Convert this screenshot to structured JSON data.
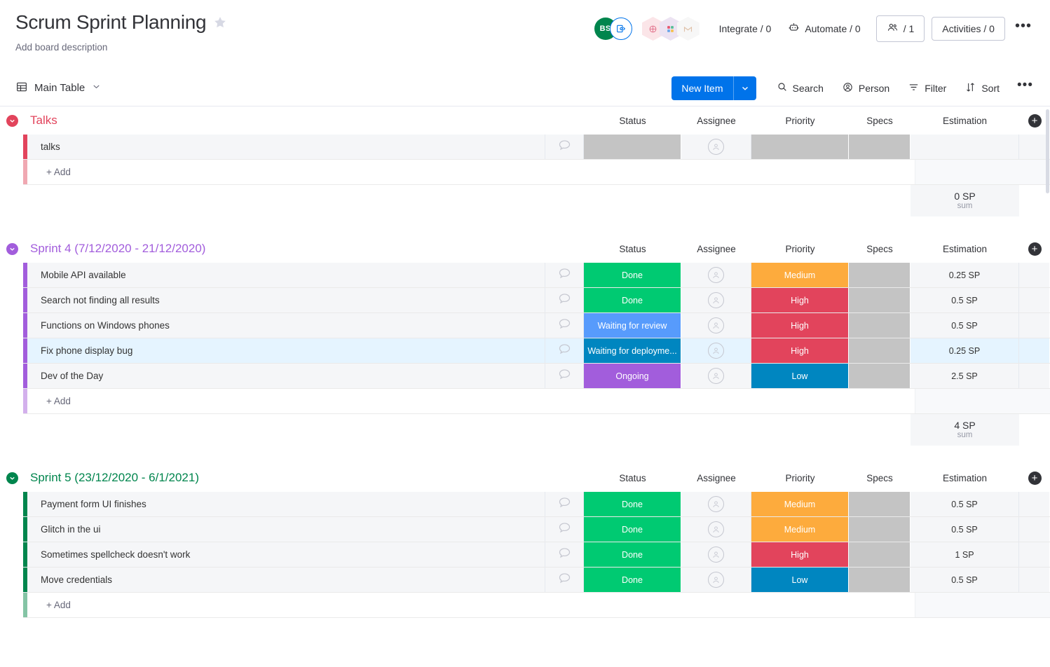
{
  "header": {
    "title": "Scrum Sprint Planning",
    "description": "Add board description",
    "star_icon": "star-icon",
    "avatar_initials": "BS",
    "integrate_label": "Integrate / 0",
    "automate_label": "Automate / 0",
    "people_count": "/ 1",
    "activities_label": "Activities / 0",
    "more_label": "•••"
  },
  "toolbar": {
    "view_label": "Main Table",
    "new_item_label": "New Item",
    "search_label": "Search",
    "person_label": "Person",
    "filter_label": "Filter",
    "sort_label": "Sort",
    "more_label": "•••"
  },
  "columns": {
    "status": "Status",
    "assignee": "Assignee",
    "priority": "Priority",
    "specs": "Specs",
    "estimation": "Estimation"
  },
  "colors": {
    "accent_blue": "#0073ea",
    "group_talks": "#e2445c",
    "group_sprint4": "#a25ddc",
    "group_sprint5": "#00854d",
    "status_done": "#00ca72",
    "status_waiting_review": "#579bfc",
    "status_waiting_deployment": "#0086c0",
    "status_ongoing": "#a25ddc",
    "priority_medium": "#fdab3d",
    "priority_high": "#e2445c",
    "priority_low": "#0086c0",
    "empty_cell": "#c4c4c4"
  },
  "add_label": "+ Add",
  "sum_label": "sum",
  "groups": [
    {
      "name": "Talks",
      "color": "#e2445c",
      "bar_color": "#e2445c",
      "add_bar_color": "#f0a8b2",
      "sum": "0 SP",
      "items": [
        {
          "name": "talks",
          "status": "",
          "status_color": "#c4c4c4",
          "priority": "",
          "priority_color": "#c4c4c4",
          "estimation": "",
          "selected": false
        }
      ]
    },
    {
      "name": "Sprint 4 (7/12/2020 - 21/12/2020)",
      "color": "#a25ddc",
      "bar_color": "#a25ddc",
      "add_bar_color": "#d3b0ec",
      "sum": "4 SP",
      "items": [
        {
          "name": "Mobile API available",
          "status": "Done",
          "status_color": "#00ca72",
          "priority": "Medium",
          "priority_color": "#fdab3d",
          "estimation": "0.25 SP",
          "selected": false
        },
        {
          "name": "Search not finding all results",
          "status": "Done",
          "status_color": "#00ca72",
          "priority": "High",
          "priority_color": "#e2445c",
          "estimation": "0.5 SP",
          "selected": false
        },
        {
          "name": "Functions on Windows phones",
          "status": "Waiting for review",
          "status_color": "#579bfc",
          "priority": "High",
          "priority_color": "#e2445c",
          "estimation": "0.5 SP",
          "selected": false
        },
        {
          "name": "Fix phone display bug",
          "status": "Waiting for deployme...",
          "status_color": "#0086c0",
          "priority": "High",
          "priority_color": "#e2445c",
          "estimation": "0.25 SP",
          "selected": true
        },
        {
          "name": "Dev of the Day",
          "status": "Ongoing",
          "status_color": "#a25ddc",
          "priority": "Low",
          "priority_color": "#0086c0",
          "estimation": "2.5 SP",
          "selected": false
        }
      ]
    },
    {
      "name": "Sprint 5 (23/12/2020 - 6/1/2021)",
      "color": "#00854d",
      "bar_color": "#00854d",
      "add_bar_color": "#84c4a5",
      "sum": null,
      "items": [
        {
          "name": "Payment form UI finishes",
          "status": "Done",
          "status_color": "#00ca72",
          "priority": "Medium",
          "priority_color": "#fdab3d",
          "estimation": "0.5 SP",
          "selected": false
        },
        {
          "name": "Glitch in the ui",
          "status": "Done",
          "status_color": "#00ca72",
          "priority": "Medium",
          "priority_color": "#fdab3d",
          "estimation": "0.5 SP",
          "selected": false
        },
        {
          "name": "Sometimes spellcheck doesn't work",
          "status": "Done",
          "status_color": "#00ca72",
          "priority": "High",
          "priority_color": "#e2445c",
          "estimation": "1 SP",
          "selected": false
        },
        {
          "name": "Move credentials",
          "status": "Done",
          "status_color": "#00ca72",
          "priority": "Low",
          "priority_color": "#0086c0",
          "estimation": "0.5 SP",
          "selected": false
        }
      ]
    }
  ]
}
